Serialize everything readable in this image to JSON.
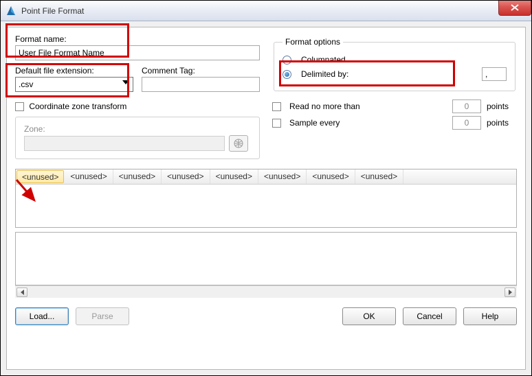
{
  "window": {
    "title": "Point File Format"
  },
  "left": {
    "format_name_label": "Format name:",
    "format_name_value": "User File Format Name",
    "default_ext_label": "Default file extension:",
    "default_ext_value": ".csv",
    "comment_tag_label": "Comment Tag:",
    "comment_tag_value": "",
    "coord_zone_label": "Coordinate zone transform",
    "zone_label": "Zone:",
    "zone_value": ""
  },
  "format_options": {
    "legend": "Format options",
    "columnated_label": "Columnated",
    "delimited_label": "Delimited by:",
    "delimited_value": ",",
    "selected": "delimited",
    "read_no_more_label": "Read no more than",
    "read_no_more_value": "0",
    "sample_every_label": "Sample every",
    "sample_every_value": "0",
    "points_label": "points"
  },
  "columns": [
    "<unused>",
    "<unused>",
    "<unused>",
    "<unused>",
    "<unused>",
    "<unused>",
    "<unused>",
    "<unused>"
  ],
  "buttons": {
    "load": "Load...",
    "parse": "Parse",
    "ok": "OK",
    "cancel": "Cancel",
    "help": "Help"
  }
}
